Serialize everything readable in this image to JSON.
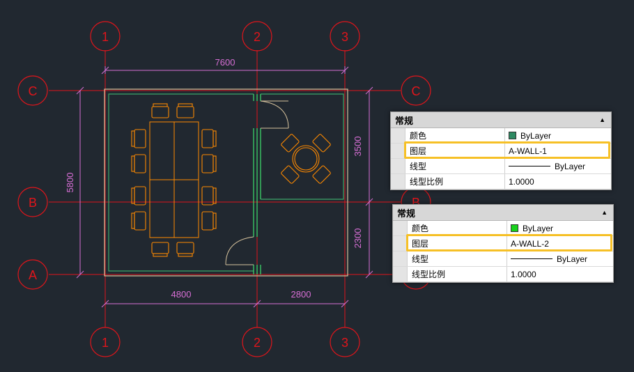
{
  "grid_axes": {
    "vertical": [
      {
        "label": "1"
      },
      {
        "label": "2"
      },
      {
        "label": "3"
      }
    ],
    "horizontal": [
      {
        "label": "C"
      },
      {
        "label": "B"
      },
      {
        "label": "A"
      }
    ]
  },
  "dimensions": {
    "top_total": "7600",
    "left_total": "5800",
    "bottom_left": "4800",
    "bottom_right": "2800",
    "right_upper": "3500",
    "right_lower": "2300"
  },
  "colors": {
    "background": "#212830",
    "axis": "#e0151b",
    "dimension": "#d86fd6",
    "wall": "#d8c49e",
    "wall_green": "#3cd36a",
    "furniture": "#ff8a00",
    "highlight": "#f6c026"
  },
  "panels": [
    {
      "header": "常规",
      "collapse_icon": "▲",
      "rows": [
        {
          "key": "颜色",
          "value": "ByLayer",
          "swatch": "#2f8a63"
        },
        {
          "key": "图层",
          "value": "A-WALL-1"
        },
        {
          "key": "线型",
          "value": "ByLayer"
        },
        {
          "key": "线型比例",
          "value": "1.0000"
        }
      ]
    },
    {
      "header": "常规",
      "collapse_icon": "▲",
      "rows": [
        {
          "key": "颜色",
          "value": "ByLayer",
          "swatch": "#19d21d"
        },
        {
          "key": "图层",
          "value": "A-WALL-2"
        },
        {
          "key": "线型",
          "value": "ByLayer"
        },
        {
          "key": "线型比例",
          "value": "1.0000"
        }
      ]
    }
  ]
}
